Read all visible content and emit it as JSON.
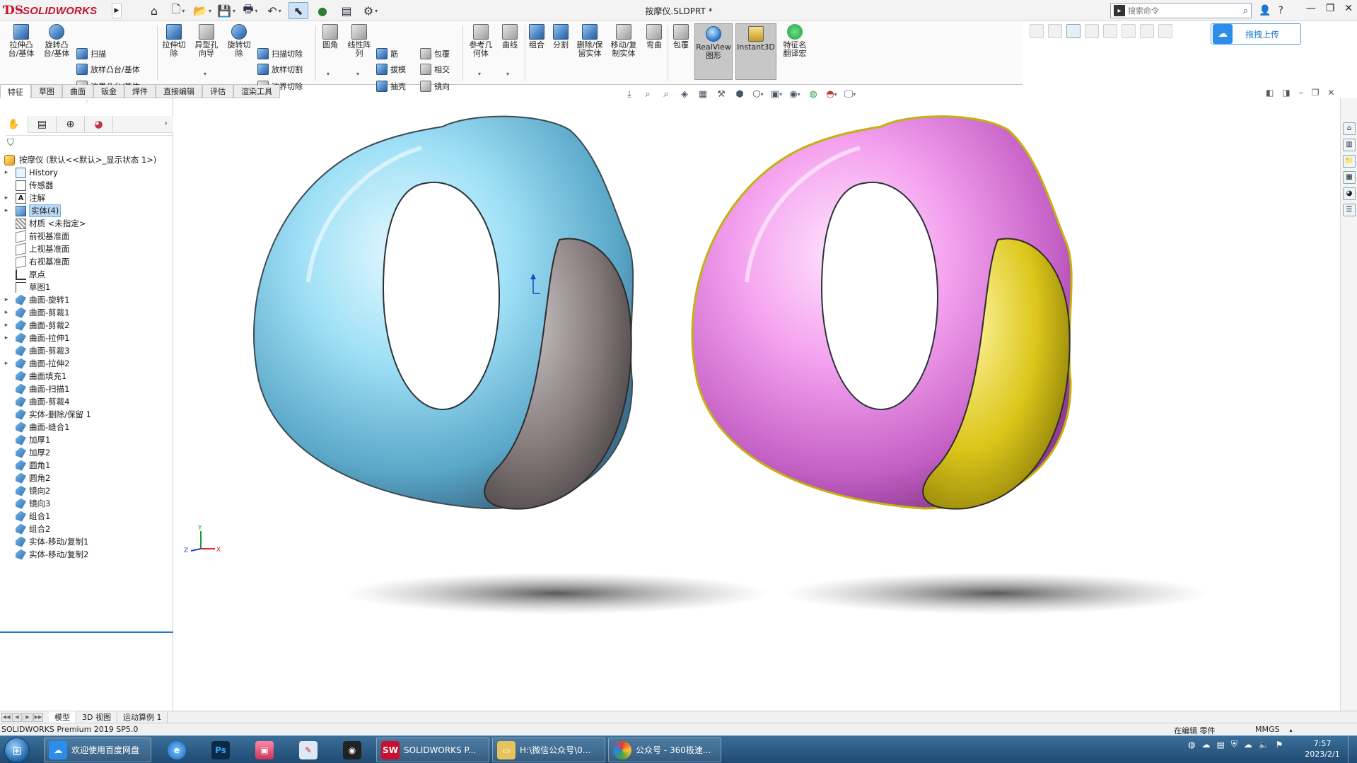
{
  "app": {
    "brand": "SOLIDWORKS",
    "document_title": "按摩仪.SLDPRT *",
    "search_placeholder": "搜索命令"
  },
  "command_manager": {
    "large_buttons": [
      {
        "label": "拉伸凸\n台/基体",
        "icon": "extrude-boss-icon"
      },
      {
        "label": "旋转凸\n台/基体",
        "icon": "revolve-boss-icon"
      },
      {
        "label": "拉伸切\n除",
        "icon": "extrude-cut-icon"
      },
      {
        "label": "异型孔\n向导",
        "icon": "hole-wizard-icon"
      },
      {
        "label": "旋转切\n除",
        "icon": "revolve-cut-icon"
      },
      {
        "label": "圆角",
        "icon": "fillet-icon"
      },
      {
        "label": "线性阵\n列",
        "icon": "linear-pattern-icon"
      },
      {
        "label": "参考几\n何体",
        "icon": "reference-geometry-icon"
      },
      {
        "label": "曲线",
        "icon": "curves-icon"
      },
      {
        "label": "组合",
        "icon": "combine-icon"
      },
      {
        "label": "分割",
        "icon": "split-icon"
      },
      {
        "label": "删除/保\n留实体",
        "icon": "delete-keep-body-icon"
      },
      {
        "label": "移动/复\n制实体",
        "icon": "move-copy-body-icon"
      },
      {
        "label": "弯曲",
        "icon": "flex-icon"
      },
      {
        "label": "包覆",
        "icon": "wrap-icon"
      },
      {
        "label": "RealView\n图形",
        "icon": "realview-icon"
      },
      {
        "label": "Instant3D",
        "icon": "instant3d-icon"
      },
      {
        "label": "特征名\n翻译宏",
        "icon": "translate-macro-icon"
      }
    ],
    "small_buttons": [
      {
        "label": "扫描",
        "icon": "sweep-icon"
      },
      {
        "label": "放样凸台/基体",
        "icon": "loft-icon"
      },
      {
        "label": "边界凸台/基体",
        "icon": "boundary-boss-icon"
      },
      {
        "label": "扫描切除",
        "icon": "swept-cut-icon"
      },
      {
        "label": "放样切割",
        "icon": "lofted-cut-icon"
      },
      {
        "label": "边界切除",
        "icon": "boundary-cut-icon"
      },
      {
        "label": "筋",
        "icon": "rib-icon"
      },
      {
        "label": "拔模",
        "icon": "draft-icon"
      },
      {
        "label": "抽壳",
        "icon": "shell-icon"
      },
      {
        "label": "包覆",
        "icon": "wrap-small-icon"
      },
      {
        "label": "相交",
        "icon": "intersect-icon"
      },
      {
        "label": "镜向",
        "icon": "mirror-icon"
      }
    ],
    "tabs": [
      "特征",
      "草图",
      "曲面",
      "钣金",
      "焊件",
      "直接编辑",
      "评估",
      "渲染工具"
    ],
    "upload_label": "拖拽上传"
  },
  "feature_manager": {
    "root_label": "按摩仪  (默认<<默认>_显示状态 1>)",
    "items": [
      {
        "label": "History",
        "icon": "history-icon",
        "expandable": true
      },
      {
        "label": "传感器",
        "icon": "sensor-icon",
        "expandable": false
      },
      {
        "label": "注解",
        "icon": "annotation-icon",
        "expandable": true
      },
      {
        "label": "实体(4)",
        "icon": "solid-bodies-icon",
        "expandable": true,
        "highlight": true
      },
      {
        "label": "材质 <未指定>",
        "icon": "material-icon",
        "expandable": false
      },
      {
        "label": "前视基准面",
        "icon": "plane-icon",
        "expandable": false
      },
      {
        "label": "上视基准面",
        "icon": "plane-icon",
        "expandable": false
      },
      {
        "label": "右视基准面",
        "icon": "plane-icon",
        "expandable": false
      },
      {
        "label": "原点",
        "icon": "origin-icon",
        "expandable": false
      },
      {
        "label": "草图1",
        "icon": "sketch-icon",
        "expandable": false
      },
      {
        "label": "曲面-旋转1",
        "icon": "surface-revolve-icon",
        "expandable": true
      },
      {
        "label": "曲面-剪裁1",
        "icon": "surface-trim-icon",
        "expandable": true
      },
      {
        "label": "曲面-剪裁2",
        "icon": "surface-trim-icon",
        "expandable": true
      },
      {
        "label": "曲面-拉伸1",
        "icon": "surface-extrude-icon",
        "expandable": true
      },
      {
        "label": "曲面-剪裁3",
        "icon": "surface-trim-icon",
        "expandable": false
      },
      {
        "label": "曲面-拉伸2",
        "icon": "surface-extrude-icon",
        "expandable": true
      },
      {
        "label": "曲面填充1",
        "icon": "surface-fill-icon",
        "expandable": false
      },
      {
        "label": "曲面-扫描1",
        "icon": "surface-sweep-icon",
        "expandable": false
      },
      {
        "label": "曲面-剪裁4",
        "icon": "surface-trim-icon",
        "expandable": false
      },
      {
        "label": "实体-删除/保留 1",
        "icon": "body-delete-icon",
        "expandable": false
      },
      {
        "label": "曲面-缝合1",
        "icon": "surface-knit-icon",
        "expandable": false
      },
      {
        "label": "加厚1",
        "icon": "thicken-icon",
        "expandable": false
      },
      {
        "label": "加厚2",
        "icon": "thicken-icon",
        "expandable": false
      },
      {
        "label": "圆角1",
        "icon": "fillet-feature-icon",
        "expandable": false
      },
      {
        "label": "圆角2",
        "icon": "fillet-feature-icon",
        "expandable": false
      },
      {
        "label": "镜向2",
        "icon": "mirror-feature-icon",
        "expandable": false
      },
      {
        "label": "镜向3",
        "icon": "mirror-feature-icon",
        "expandable": false
      },
      {
        "label": "组合1",
        "icon": "combine-feature-icon",
        "expandable": false
      },
      {
        "label": "组合2",
        "icon": "combine-feature-icon",
        "expandable": false
      },
      {
        "label": "实体-移动/复制1",
        "icon": "move-copy-feature-icon",
        "expandable": false
      },
      {
        "label": "实体-移动/复制2",
        "icon": "move-copy-feature-icon",
        "expandable": false
      }
    ]
  },
  "bottom_tabs": [
    "模型",
    "3D 视图",
    "运动算例 1"
  ],
  "status": {
    "left": "SOLIDWORKS Premium 2019 SP5.0",
    "mode": "在编辑 零件",
    "units": "MMGS"
  },
  "taskbar": {
    "items": [
      {
        "label": "欢迎使用百度网盘",
        "icon": "baidu-netdisk-icon"
      },
      {
        "label": "SOLIDWORKS P...",
        "icon": "solidworks-task-icon"
      },
      {
        "label": "H:\\微信公众号\\0...",
        "icon": "folder-icon"
      },
      {
        "label": "公众号 - 360极速...",
        "icon": "browser-360-icon"
      }
    ],
    "time": "7:57",
    "date": "2023/2/1"
  },
  "colors": {
    "ring1_body": "#8fd8f0",
    "ring1_side": "#8a7f80",
    "ring2_body": "#f28ff0",
    "ring2_side": "#e6d21e",
    "accent": "#1e7bd0"
  }
}
